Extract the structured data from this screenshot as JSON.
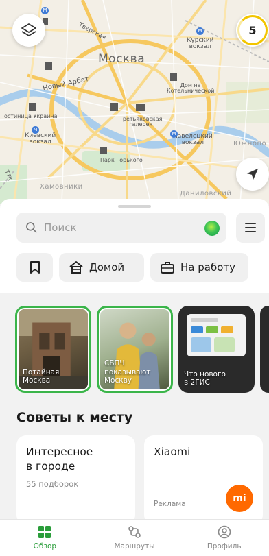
{
  "map": {
    "city_label": "Москва",
    "labels": {
      "kursky": "Курский\nвокзал",
      "tverskaya": "Тверская",
      "noviy_arbat": "Новый Арбат",
      "dom_na_kotel": "Дом на\nКотельнической",
      "ukraina": "остиница Украина",
      "kievsky": "Киевский\nвокзал",
      "tretyakov": "Третьяковская\nгалерея",
      "paveletsky": "Павелецкий\nвокзал",
      "yuzhnoport": "Южнопо",
      "park_gorkogo": "Парк Горького",
      "khamovniki": "Хамовники",
      "danilovsky": "Даниловский",
      "rlt": "ТТК"
    },
    "layers_icon": "layers-icon",
    "notifications_count": "5",
    "locate_icon": "navigation-arrow-icon"
  },
  "search": {
    "placeholder": "Поиск"
  },
  "quick_chips": {
    "home_label": "Домой",
    "work_label": "На работу"
  },
  "stories": [
    {
      "caption": "Потайная\nМосква",
      "ring": true
    },
    {
      "caption": "СБПЧ\nпоказывают\nМоскву",
      "ring": true
    },
    {
      "caption": "Что нового\nв 2ГИС",
      "ring": false
    }
  ],
  "section": {
    "title": "Советы к месту"
  },
  "cards": [
    {
      "title": "Интересное\nв городе",
      "subtitle": "55 подборок"
    },
    {
      "title": "Xiaomi",
      "ad_label": "Реклама",
      "logo_text": "mi"
    }
  ],
  "bottom_nav": [
    {
      "label": "Обзор",
      "icon": "grid-icon",
      "active": true
    },
    {
      "label": "Маршруты",
      "icon": "routes-icon",
      "active": false
    },
    {
      "label": "Профиль",
      "icon": "profile-icon",
      "active": false
    }
  ],
  "colors": {
    "accent_green": "#2a9d3a",
    "story_ring": "#3bb54a",
    "badge_ring": "#f2c500",
    "xiaomi_orange": "#ff6900"
  }
}
